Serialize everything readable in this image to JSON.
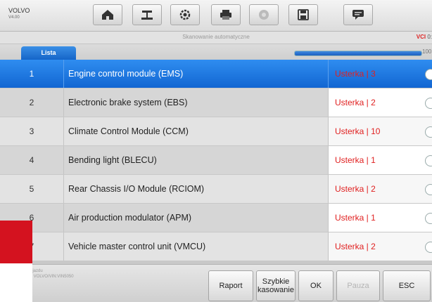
{
  "brand": {
    "name": "VOLVO",
    "sub": "V4.00"
  },
  "toolbar": {
    "buttons": [
      {
        "name": "home-button",
        "icon": "home-icon"
      },
      {
        "name": "vehicle-swap-button",
        "icon": "car-lift-icon"
      },
      {
        "name": "settings-button",
        "icon": "gear-icon"
      },
      {
        "name": "print-button",
        "icon": "printer-icon"
      },
      {
        "name": "help-button",
        "icon": "help-icon"
      },
      {
        "name": "save-button",
        "icon": "save-icon"
      },
      {
        "name": "data-logging-button",
        "icon": "chat-icon"
      }
    ]
  },
  "status": {
    "title": "Skanowanie automatyczne",
    "vci_label": "VCI",
    "vci_value": "0:"
  },
  "tab": {
    "label": "Lista"
  },
  "progress": {
    "percent": 100,
    "label": "100"
  },
  "rows": [
    {
      "num": "1",
      "name": "Engine control module (EMS)",
      "fault": "Usterka | 3",
      "selected": true
    },
    {
      "num": "2",
      "name": "Electronic brake system (EBS)",
      "fault": "Usterka | 2",
      "selected": false
    },
    {
      "num": "3",
      "name": "Climate Control Module (CCM)",
      "fault": "Usterka | 10",
      "selected": false
    },
    {
      "num": "4",
      "name": "Bending light (BLECU)",
      "fault": "Usterka | 1",
      "selected": false
    },
    {
      "num": "5",
      "name": "Rear Chassis I/O Module (RCIOM)",
      "fault": "Usterka | 2",
      "selected": false
    },
    {
      "num": "6",
      "name": "Air production modulator (APM)",
      "fault": "Usterka | 1",
      "selected": false
    },
    {
      "num": "7",
      "name": "Vehicle master control unit (VMCU)",
      "fault": "Usterka | 2",
      "selected": false
    }
  ],
  "vehicle_info": {
    "line1": "Info pojazdu",
    "line2": "Model: VOLVO/VIN:VIN5050"
  },
  "buttons": {
    "report": "Raport",
    "quick_clear": "Szybkie kasowanie",
    "ok": "OK",
    "pause": "Pauza",
    "esc": "ESC"
  },
  "colors": {
    "accent": "#1a6fd8",
    "fault": "#e02020",
    "brand_red": "#d4121f"
  }
}
